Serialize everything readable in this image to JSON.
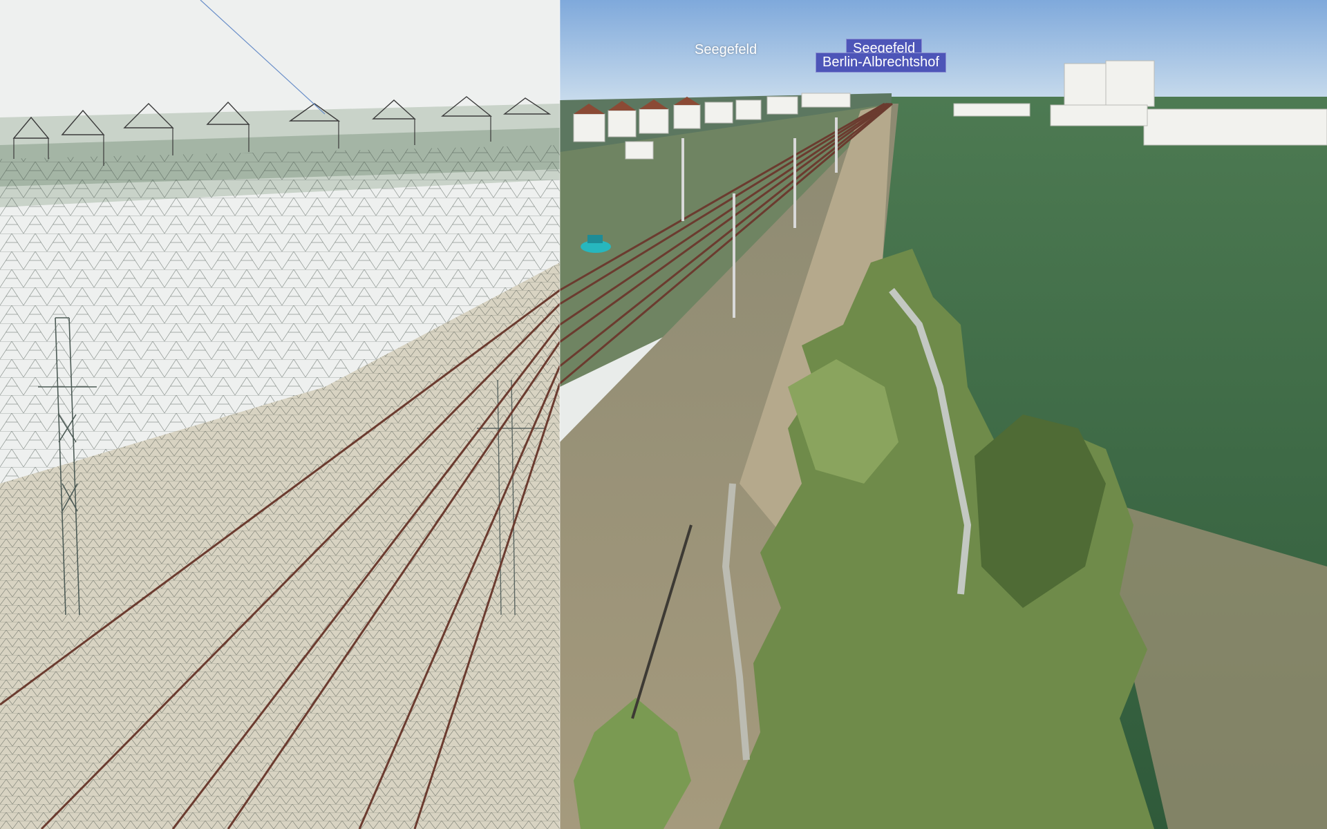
{
  "viewer": {
    "left_mode": "wireframe-mesh",
    "right_mode": "textured-mesh",
    "colors": {
      "wire_background": "#eef0ef",
      "sky": "#8fb6df",
      "grass": "#3f6a45",
      "rail": "#6b3b2f",
      "label_box": "#4d55b8"
    }
  },
  "place_labels": [
    {
      "text": "Seegefeld",
      "style": "plain"
    },
    {
      "text": "Seegefeld",
      "style": "boxed"
    },
    {
      "text": "Berlin-Albrechtshof",
      "style": "boxed"
    }
  ]
}
